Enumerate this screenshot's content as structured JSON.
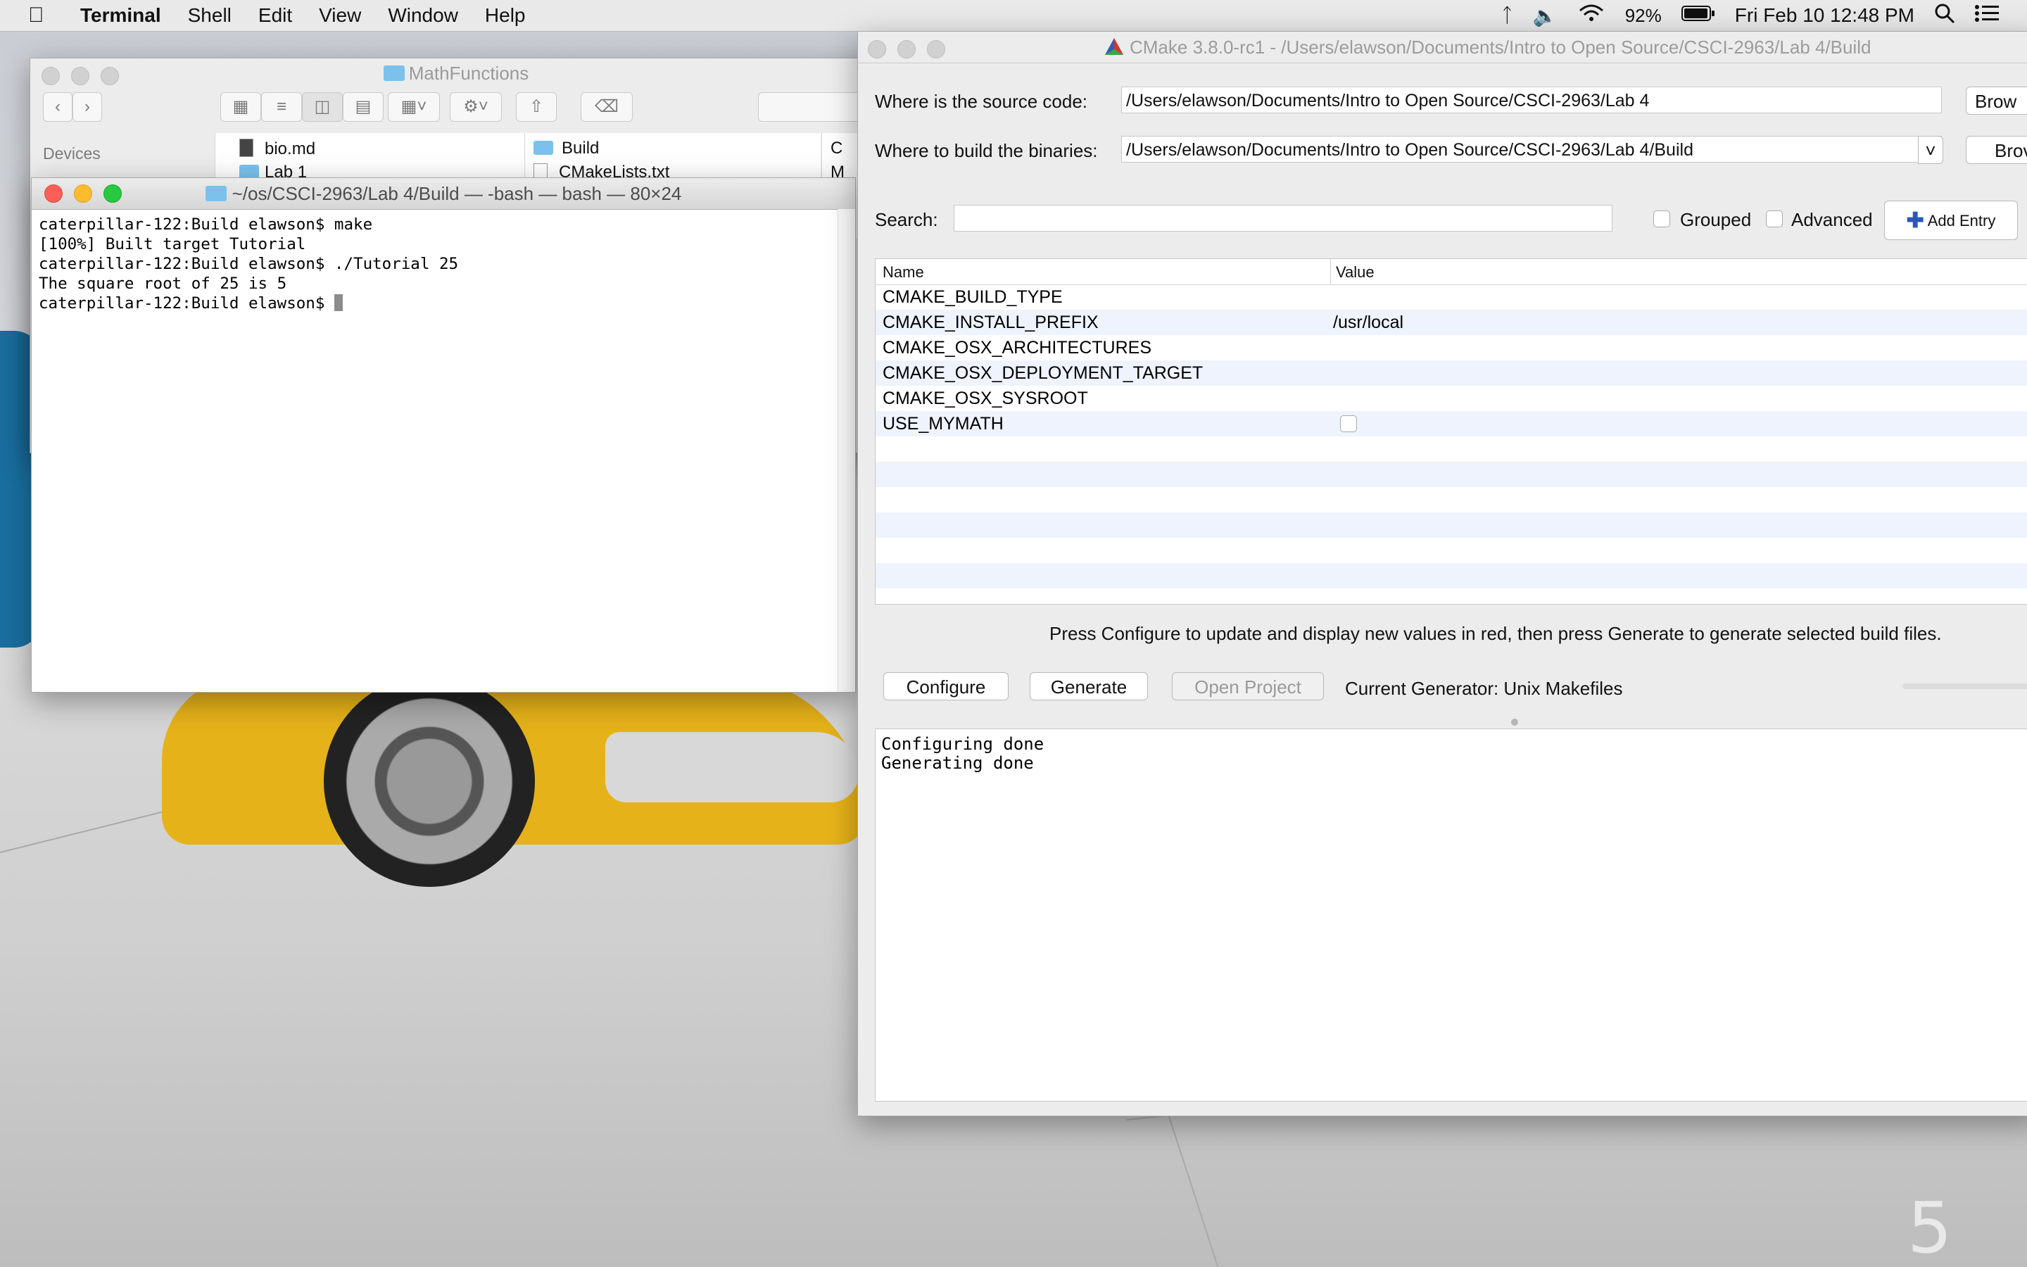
{
  "menubar": {
    "app": "Terminal",
    "items": [
      "Shell",
      "Edit",
      "View",
      "Window",
      "Help"
    ],
    "battery": "92%",
    "datetime": "Fri Feb 10  12:48 PM"
  },
  "finder": {
    "title": "MathFunctions",
    "sidebar_section": "Devices",
    "items": [
      "bio.md",
      "Lab 1",
      "Build",
      "CMakeLists.txt",
      "C",
      "M"
    ]
  },
  "terminal": {
    "title": "~/os/CSCI-2963/Lab 4/Build — -bash — bash — 80×24",
    "lines": [
      "caterpillar-122:Build elawson$ make",
      "[100%] Built target Tutorial",
      "caterpillar-122:Build elawson$ ./Tutorial 25",
      "The square root of 25 is 5",
      "caterpillar-122:Build elawson$ "
    ]
  },
  "cmake": {
    "title": "CMake 3.8.0-rc1 - /Users/elawson/Documents/Intro to Open Source/CSCI-2963/Lab 4/Build",
    "source_label": "Where is the source code:",
    "source_value": "/Users/elawson/Documents/Intro to Open Source/CSCI-2963/Lab 4",
    "binaries_label": "Where to build the binaries:",
    "binaries_value": "/Users/elawson/Documents/Intro to Open Source/CSCI-2963/Lab 4/Build",
    "browse_source": "Brow",
    "browse_build": "Brov",
    "search_label": "Search:",
    "grouped_label": "Grouped",
    "advanced_label": "Advanced",
    "add_entry_label": "Add Entry",
    "table": {
      "col_name": "Name",
      "col_value": "Value",
      "rows": [
        {
          "name": "CMAKE_BUILD_TYPE",
          "value": ""
        },
        {
          "name": "CMAKE_INSTALL_PREFIX",
          "value": "/usr/local"
        },
        {
          "name": "CMAKE_OSX_ARCHITECTURES",
          "value": ""
        },
        {
          "name": "CMAKE_OSX_DEPLOYMENT_TARGET",
          "value": ""
        },
        {
          "name": "CMAKE_OSX_SYSROOT",
          "value": ""
        },
        {
          "name": "USE_MYMATH",
          "value": ""
        }
      ]
    },
    "hint": "Press Configure to update and display new values in red, then press Generate to generate selected build files.",
    "configure_label": "Configure",
    "generate_label": "Generate",
    "open_project_label": "Open Project",
    "generator": "Current Generator: Unix Makefiles",
    "output_lines": [
      "Configuring done",
      "Generating done"
    ]
  }
}
